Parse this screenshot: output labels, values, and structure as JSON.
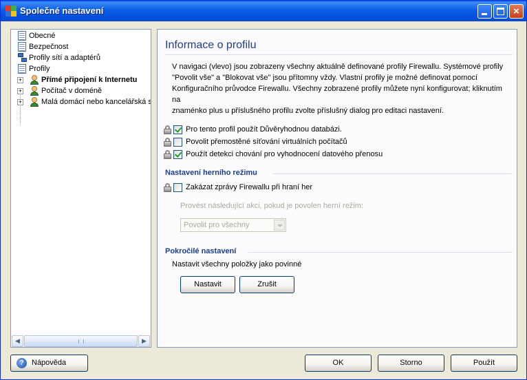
{
  "window": {
    "title": "Společné nastavení",
    "controls": {
      "minimize": "minimize",
      "maximize": "maximize",
      "close": "×"
    }
  },
  "tree": {
    "items": [
      {
        "label": "Obecné",
        "icon": "document-icon"
      },
      {
        "label": "Bezpečnost",
        "icon": "document-icon"
      },
      {
        "label": "Profily sítí a adaptérů",
        "icon": "network-icon"
      },
      {
        "label": "Profily",
        "icon": "document-icon"
      },
      {
        "label": "Přímé připojení k Internetu",
        "icon": "profile-icon",
        "expander": "+"
      },
      {
        "label": "Počítač v doméně",
        "icon": "profile-icon",
        "expander": "+"
      },
      {
        "label": "Malá domácí nebo kancelářská s",
        "icon": "profile-icon",
        "expander": "+"
      }
    ],
    "scroll_left": "◀",
    "scroll_right": "▶"
  },
  "panel": {
    "title": "Informace o profilu",
    "info_lines": [
      "V navigaci (vlevo) jsou zobrazeny všechny aktuálně definované profily Firewallu. Systémové profily",
      "\"Povolit vše\" a \"Blokovat vše\" jsou přítomny vždy. Vlastní profily je možné definovat pomocí",
      "Konfiguračního průvodce Firewallu. Všechny zobrazené profily můžete nyní konfigurovat; kliknutím na",
      "znaménko plus u příslušného profilu zvolte příslušný dialog pro editaci nastavení."
    ],
    "options": [
      {
        "label": "Pro tento profil použít Důvěryhodnou databázi.",
        "checked": true
      },
      {
        "label": "Povolit přemostěné síťování virtuálních počítačů",
        "checked": false
      },
      {
        "label": "Použít detekci chování pro vyhodnocení datového přenosu",
        "checked": true
      }
    ],
    "game_section": {
      "heading": "Nastavení herního režimu",
      "checkbox": {
        "label": "Zakázat zprávy Firewallu při hraní her",
        "checked": false
      },
      "action_label": "Provést následující akci, pokud je povolen herní režim:",
      "select_value": "Povolit pro všechny"
    },
    "advanced_section": {
      "heading": "Pokročilé nastavení",
      "description": "Nastavit všechny položky jako povinné",
      "set_button": "Nastavit",
      "cancel_button": "Zrušit"
    }
  },
  "footer": {
    "help_button": "Nápověda",
    "help_icon": "?",
    "ok_button": "OK",
    "storno_button": "Storno",
    "apply_button": "Použít"
  }
}
